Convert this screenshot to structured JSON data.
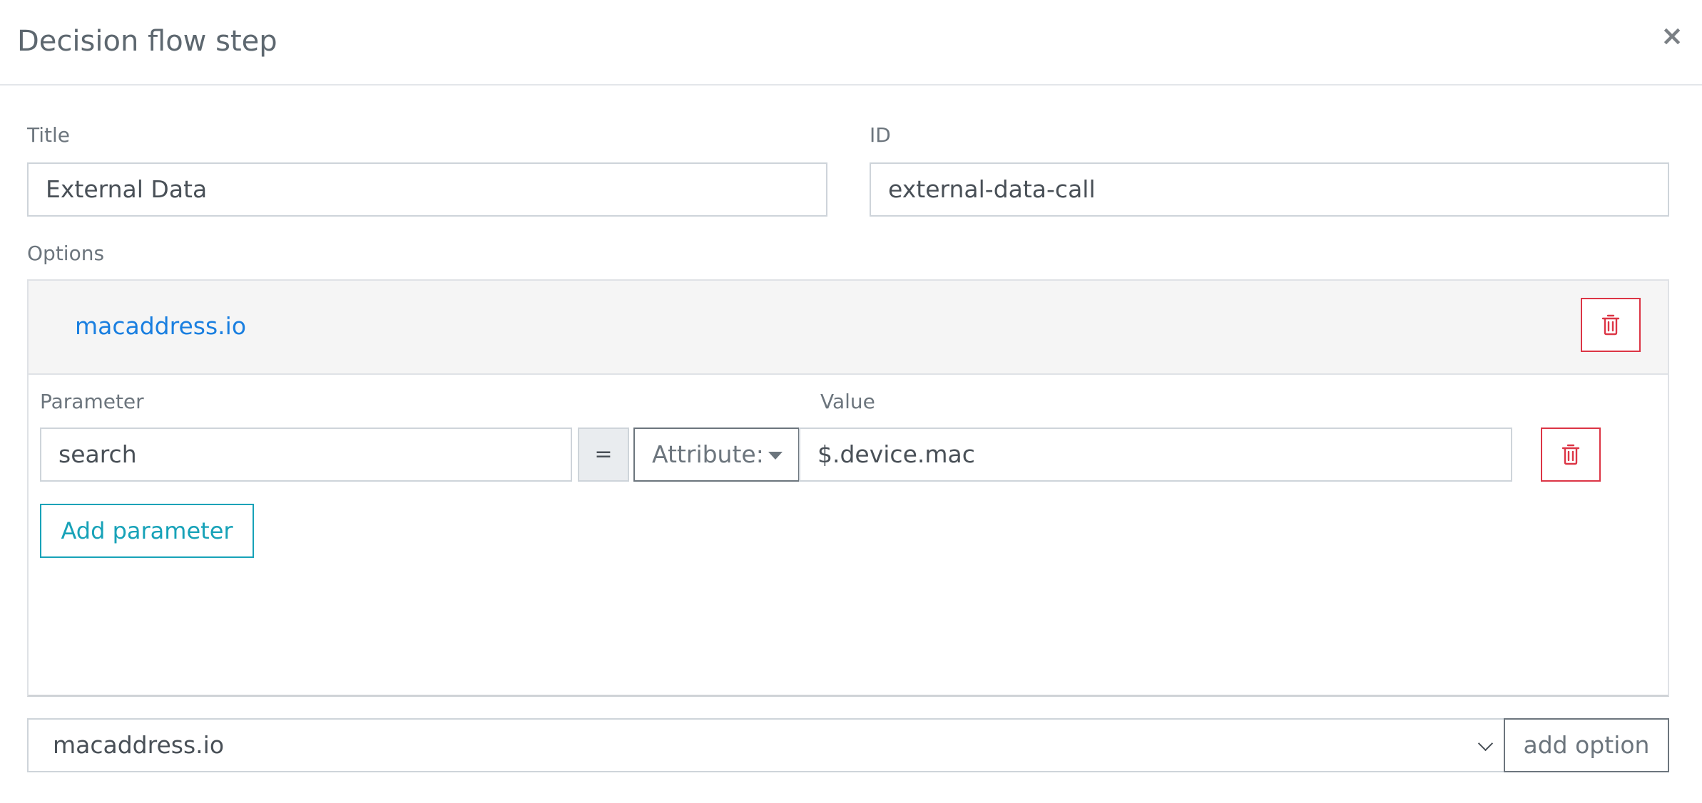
{
  "modal": {
    "title": "Decision flow step",
    "close_icon": "×"
  },
  "form": {
    "title_label": "Title",
    "title_value": "External Data",
    "id_label": "ID",
    "id_value": "external-data-call",
    "options_label": "Options"
  },
  "option": {
    "name": "macaddress.io",
    "delete_icon": "trash-icon",
    "parameter_header": "Parameter",
    "value_header": "Value",
    "parameters": [
      {
        "name": "search",
        "operator": "=",
        "type_label": "Attribute:",
        "value": "$.device.mac"
      }
    ],
    "add_parameter_label": "Add parameter"
  },
  "footer": {
    "selected_option": "macaddress.io",
    "add_option_label": "add option"
  },
  "colors": {
    "danger": "#dc3545",
    "info": "#17a2b8",
    "link": "#1a7fe0",
    "secondary": "#6c757d"
  }
}
